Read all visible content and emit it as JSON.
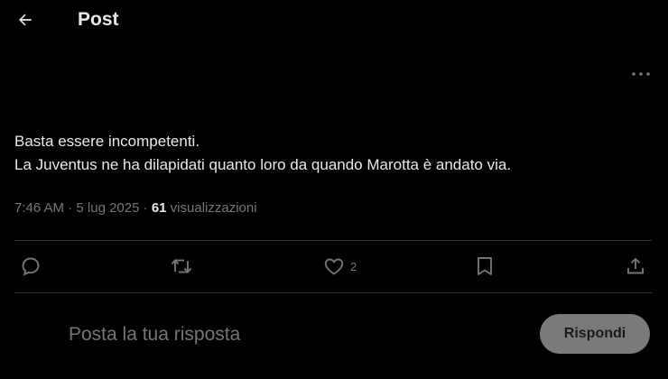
{
  "header": {
    "back_icon": "arrow-left-icon",
    "title": "Post",
    "more_icon": "more-horizontal-icon"
  },
  "tweet": {
    "lines": [
      "Basta essere incompetenti.",
      "La Juventus ne ha dilapidati quanto loro da quando Marotta è andato via."
    ],
    "time": "7:46 AM",
    "date": "5 lug 2025",
    "separator": "·",
    "views_count": "61",
    "views_label": "visualizzazioni"
  },
  "actions": {
    "reply_icon": "reply-icon",
    "repost_icon": "repost-icon",
    "like_icon": "heart-icon",
    "like_count": "2",
    "bookmark_icon": "bookmark-icon",
    "share_icon": "share-icon"
  },
  "reply": {
    "placeholder": "Posta la tua risposta",
    "button_label": "Rispondi"
  },
  "colors": {
    "background": "#000000",
    "text": "#e7e9ea",
    "muted": "#71767b",
    "divider": "#2f3336",
    "reply_button_bg": "#7a7a7a"
  }
}
